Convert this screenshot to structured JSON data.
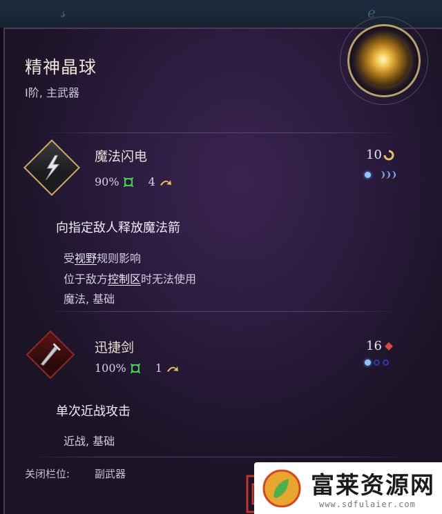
{
  "item": {
    "name": "精神晶球",
    "tier_slot": "I阶, 主武器"
  },
  "skills": [
    {
      "name": "魔法闪电",
      "accuracy": "90%",
      "range": "4",
      "cost": "10",
      "description": "向指定敌人释放魔法箭",
      "notes": [
        {
          "pre": "受",
          "kw": "视野",
          "post": "规则影响"
        },
        {
          "pre": "位于敌方",
          "kw": "控制区",
          "post": "时无法使用"
        }
      ],
      "tags": "魔法, 基础",
      "pip_state": "1 filled, 2 moons"
    },
    {
      "name": "迅捷剑",
      "accuracy": "100%",
      "range": "1",
      "cost": "16",
      "description": "单次近战攻击",
      "tags": "近战, 基础",
      "pip_state": "1 filled, 2 empty"
    }
  ],
  "footer": {
    "label": "关闭栏位:",
    "value": "副武器"
  },
  "watermark": {
    "text": "富莱资源网",
    "url": "www.sdfulaier.com"
  },
  "colors": {
    "panel_bg": "#2a1b3d",
    "gold_accent": "#d2a961",
    "pip_blue": "#8fc4ff",
    "accuracy_green": "#3fcf4f",
    "range_yellow": "#e8c15a"
  },
  "icons": [
    "orb-icon",
    "lightning-icon",
    "sword-icon",
    "hit-chance-icon",
    "range-arrow-icon",
    "cost-icon"
  ]
}
